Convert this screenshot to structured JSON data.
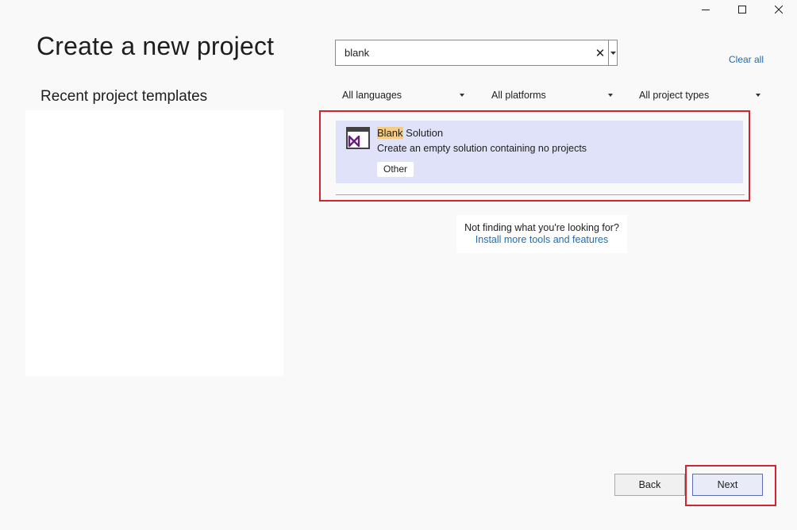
{
  "window": {
    "minimize_icon": "minimize-icon",
    "maximize_icon": "maximize-icon",
    "close_icon": "close-icon"
  },
  "header": {
    "title": "Create a new project"
  },
  "recent": {
    "title": "Recent project templates",
    "items": []
  },
  "search": {
    "value": "blank",
    "clear_glyph": "✕",
    "clear_all_label": "Clear all"
  },
  "filters": {
    "languages": "All languages",
    "platforms": "All platforms",
    "project_types": "All project types"
  },
  "templates": [
    {
      "title_highlight": "Blank",
      "title_rest": " Solution",
      "description": "Create an empty solution containing no projects",
      "tag": "Other",
      "icon": "visual-studio-solution-icon",
      "selected": true
    }
  ],
  "not_finding": {
    "question": "Not finding what you're looking for?",
    "link": "Install more tools and features"
  },
  "footer": {
    "back_label": "Back",
    "next_label": "Next"
  },
  "colors": {
    "accent_link": "#1f6bb5",
    "selected_bg": "#dfe2f8",
    "search_highlight": "#f5cc84",
    "annotation_red": "#d02530",
    "vs_purple": "#68217a"
  }
}
